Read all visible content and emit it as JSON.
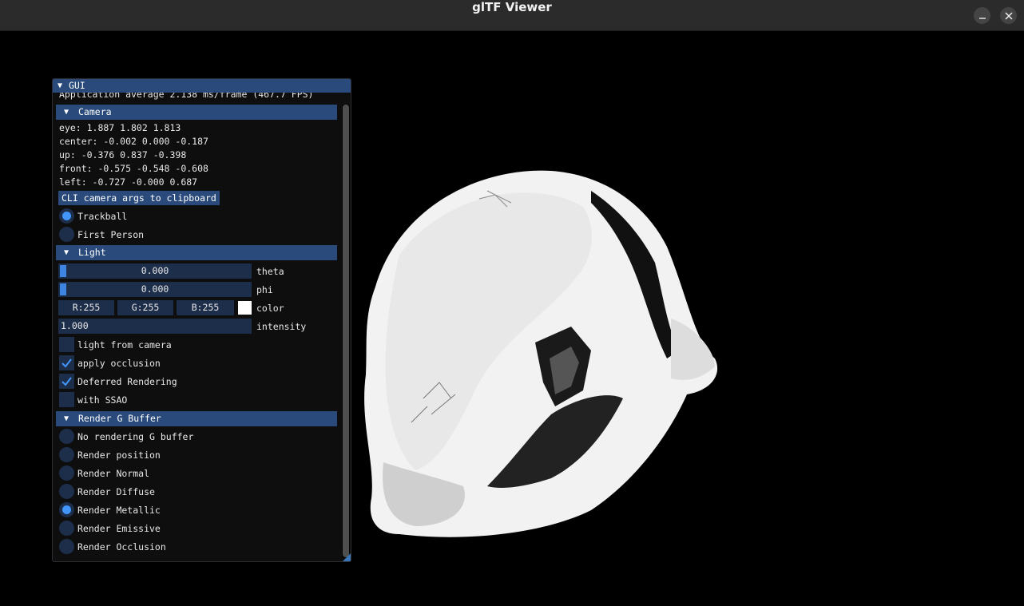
{
  "window": {
    "title": "glTF Viewer"
  },
  "gui": {
    "title": "GUI",
    "fps_text": "Application average 2.138 ms/frame (467.7 FPS)",
    "camera": {
      "header": "Camera",
      "eye": "eye: 1.887 1.802 1.813",
      "center": "center: -0.002 0.000 -0.187",
      "up": "up: -0.376 0.837 -0.398",
      "front": "front: -0.575 -0.548 -0.608",
      "left": "left: -0.727 -0.000 0.687",
      "clipboard_button": "CLI camera args to clipboard",
      "modes": [
        {
          "label": "Trackball",
          "selected": true
        },
        {
          "label": "First Person",
          "selected": false
        }
      ]
    },
    "light": {
      "header": "Light",
      "theta_value": "0.000",
      "theta_label": "theta",
      "phi_value": "0.000",
      "phi_label": "phi",
      "r": "R:255",
      "g": "G:255",
      "b": "B:255",
      "color_label": "color",
      "swatch_color": "#ffffff",
      "intensity_value": "1.000",
      "intensity_label": "intensity",
      "checkboxes": [
        {
          "label": "light from camera",
          "checked": false
        },
        {
          "label": "apply occlusion",
          "checked": true
        },
        {
          "label": "Deferred Rendering",
          "checked": true
        },
        {
          "label": "with SSAO",
          "checked": false
        }
      ]
    },
    "gbuffer": {
      "header": "Render G Buffer",
      "options": [
        {
          "label": "No rendering G buffer",
          "selected": false
        },
        {
          "label": "Render position",
          "selected": false
        },
        {
          "label": "Render Normal",
          "selected": false
        },
        {
          "label": "Render Diffuse",
          "selected": false
        },
        {
          "label": "Render Metallic",
          "selected": true
        },
        {
          "label": "Render Emissive",
          "selected": false
        },
        {
          "label": "Render Occlusion",
          "selected": false
        }
      ]
    }
  },
  "colors": {
    "accent": "#4296fa",
    "header": "#294a7a",
    "frame": "#1d2e4b"
  }
}
